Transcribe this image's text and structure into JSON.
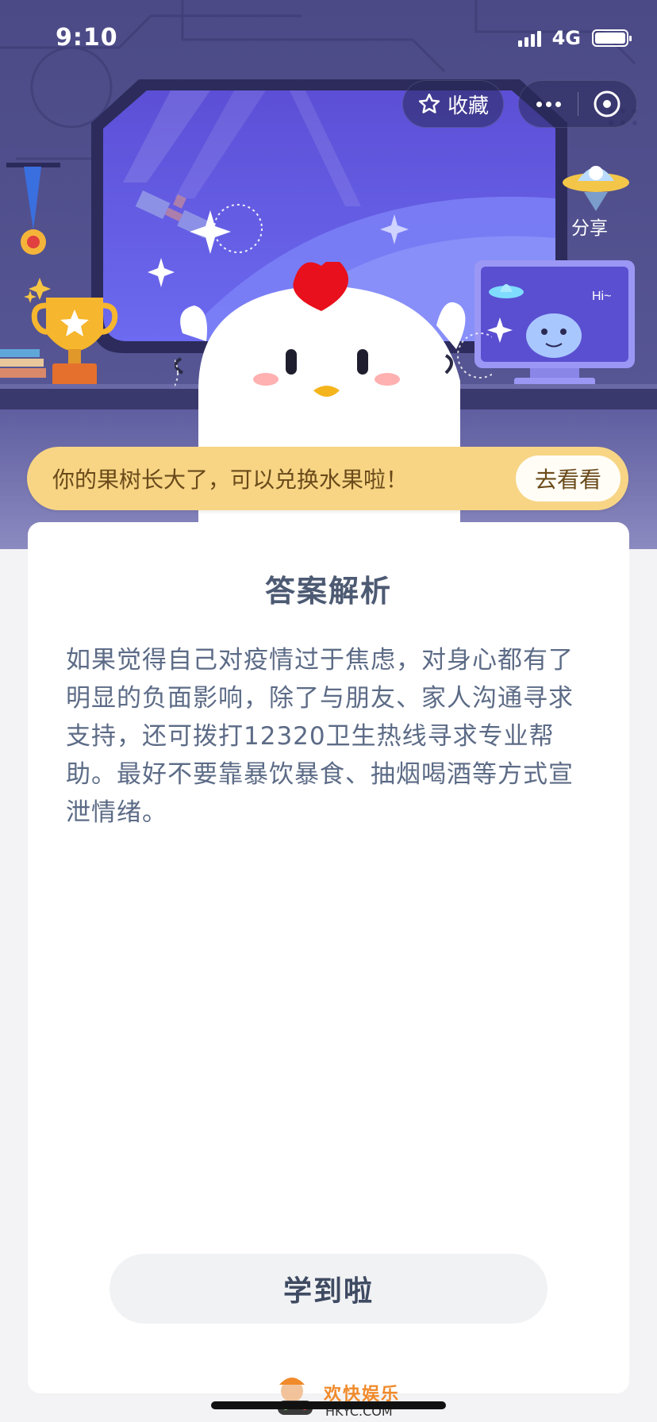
{
  "status_bar": {
    "time": "9:10",
    "network": "4G"
  },
  "top_actions": {
    "favorite_label": "收藏",
    "share_label": "分享"
  },
  "scene": {
    "monitor_text": "Hi~"
  },
  "banner": {
    "message": "你的果树长大了，可以兑换水果啦！",
    "button_label": "去看看"
  },
  "card": {
    "title": "答案解析",
    "body": "如果觉得自己对疫情过于焦虑，对身心都有了明显的负面影响，除了与朋友、家人沟通寻求支持，还可拨打12320卫生热线寻求专业帮助。最好不要靠暴饮暴食、抽烟喝酒等方式宣泄情绪。",
    "action_label": "学到啦"
  },
  "watermark": {
    "cn": "欢快娱乐",
    "en": "HKYC.COM"
  },
  "colors": {
    "scene_bg": "#4b4a86",
    "banner_bg": "#f7d585",
    "banner_text": "#6a4a1a",
    "title_text": "#4d5a73",
    "body_text": "#5c6b86",
    "button_bg": "#f1f2f4"
  }
}
